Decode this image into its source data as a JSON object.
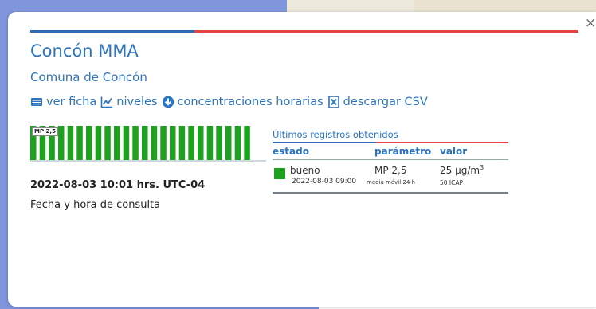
{
  "popup": {
    "title": "Concón MMA",
    "subtitle": "Comuna de Concón",
    "close_label": "×",
    "accent_blue": "#2f6bb2",
    "accent_red": "#e3443e",
    "link_color": "#2a74c0"
  },
  "links": [
    {
      "label": "ver ficha",
      "icon": "id-card-icon"
    },
    {
      "label": "niveles",
      "icon": "line-chart-icon"
    },
    {
      "label": "concentraciones horarias",
      "icon": "download-circle-icon"
    },
    {
      "label": "descargar CSV",
      "icon": "excel-file-icon"
    }
  ],
  "bars_widget": {
    "label": "MP 2,5",
    "bar_color": "#1ea11e",
    "bar_count": 24
  },
  "consult": {
    "datetime": "2022-08-03 10:01 hrs. UTC-04",
    "caption": "Fecha y hora de consulta"
  },
  "records": {
    "title": "Últimos registros obtenidos",
    "headers": {
      "estado": "estado",
      "parametro": "parámetro",
      "valor": "valor"
    },
    "rows": [
      {
        "estado": "bueno",
        "estado_color": "#1ea11e",
        "parametro": "MP 2,5",
        "valor": "25 µg/m",
        "valor_sup": "3",
        "fecha": "2022-08-03 09:00",
        "detalle": "media móvil 24 h",
        "icap": "50 ICAP"
      }
    ]
  }
}
